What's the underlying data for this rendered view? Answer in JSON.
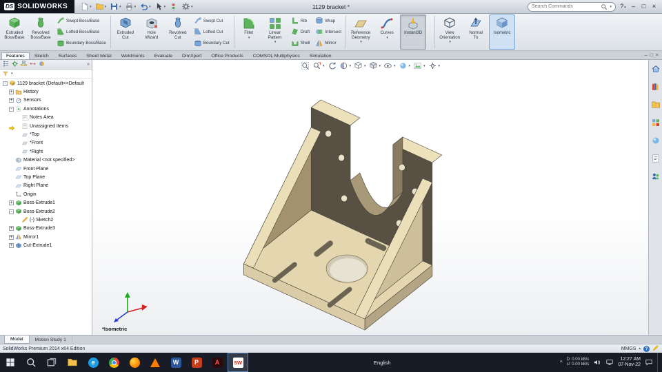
{
  "colors": {
    "accent_blue": "#2f6fc1",
    "model_tan": "#e4d7af",
    "model_dark": "#575043",
    "taskbar_bg": "#171c26"
  },
  "title_bar": {
    "brand_mark": "DS",
    "brand": "SOLIDWORKS",
    "document_title": "1129 bracket *",
    "search": {
      "placeholder": "Search Commands"
    },
    "qat": [
      {
        "name": "new-document",
        "caret": true
      },
      {
        "name": "open-folder",
        "caret": true
      },
      {
        "name": "save",
        "caret": true
      },
      {
        "name": "print",
        "caret": true
      },
      {
        "name": "undo",
        "caret": true
      },
      {
        "name": "select-arrow",
        "caret": true
      },
      {
        "name": "rebuild",
        "caret": false
      },
      {
        "name": "options-gear",
        "caret": true
      }
    ],
    "window_buttons": [
      "help",
      "minimize",
      "restore",
      "close"
    ]
  },
  "ribbon": {
    "groups": [
      {
        "buttons": [
          {
            "label": "Extruded\nBoss/Base",
            "icon": "extruded-boss",
            "size": "large"
          },
          {
            "label": "Revolved\nBoss/Base",
            "icon": "revolved-boss",
            "size": "large"
          },
          {
            "stack": [
              {
                "label": "Swept Boss/Base",
                "icon": "swept-boss"
              },
              {
                "label": "Lofted Boss/Base",
                "icon": "lofted-boss"
              },
              {
                "label": "Boundary Boss/Base",
                "icon": "boundary-boss"
              }
            ]
          }
        ]
      },
      {
        "buttons": [
          {
            "label": "Extruded\nCut",
            "icon": "extruded-cut",
            "size": "large"
          },
          {
            "label": "Hole\nWizard",
            "icon": "hole-wizard",
            "size": "large"
          },
          {
            "label": "Revolved\nCut",
            "icon": "revolved-cut",
            "size": "large"
          },
          {
            "stack": [
              {
                "label": "Swept Cut",
                "icon": "swept-cut"
              },
              {
                "label": "Lofted Cut",
                "icon": "lofted-cut"
              },
              {
                "label": "Boundary Cut",
                "icon": "boundary-cut"
              }
            ]
          }
        ]
      },
      {
        "buttons": [
          {
            "label": "Fillet",
            "icon": "fillet",
            "size": "large",
            "caret": true
          },
          {
            "label": "Linear\nPattern",
            "icon": "linear-pattern",
            "size": "large",
            "caret": true
          },
          {
            "stack": [
              {
                "label": "Rib",
                "icon": "rib"
              },
              {
                "label": "Draft",
                "icon": "draft"
              },
              {
                "label": "Shell",
                "icon": "shell"
              }
            ]
          },
          {
            "stack": [
              {
                "label": "Wrap",
                "icon": "wrap"
              },
              {
                "label": "Intersect",
                "icon": "intersect"
              },
              {
                "label": "Mirror",
                "icon": "mirror"
              }
            ]
          }
        ]
      },
      {
        "buttons": [
          {
            "label": "Reference\nGeometry",
            "icon": "reference-geometry",
            "size": "large",
            "caret": true
          },
          {
            "label": "Curves",
            "icon": "curves",
            "size": "large",
            "caret": true
          },
          {
            "label": "Instant3D",
            "icon": "instant3d",
            "size": "large",
            "pressed": true
          }
        ]
      },
      {
        "buttons": [
          {
            "label": "View\nOrientation",
            "icon": "view-orientation",
            "size": "large",
            "caret": true
          },
          {
            "label": "Normal\nTo",
            "icon": "normal-to",
            "size": "large"
          },
          {
            "label": "Isometric",
            "icon": "isometric-view",
            "size": "large",
            "selected": true
          }
        ]
      }
    ]
  },
  "command_tabs": {
    "items": [
      "Features",
      "Sketch",
      "Surfaces",
      "Sheet Metal",
      "Weldments",
      "Evaluate",
      "DimXpert",
      "Office Products",
      "COMSOL Multiphysics",
      "Simulation"
    ],
    "active": "Features",
    "window_controls": [
      "minimize",
      "restore",
      "close"
    ]
  },
  "feature_tree": {
    "header_icons": [
      "featuremanager",
      "propertymanager",
      "configurationmanager",
      "dimxpertmanager",
      "displaymanager"
    ],
    "items": [
      {
        "label": "1129 bracket  (Default<<Default",
        "icon": "part",
        "depth": 0,
        "expander": "open"
      },
      {
        "label": "History",
        "icon": "history",
        "depth": 1,
        "expander": "closed"
      },
      {
        "label": "Sensors",
        "icon": "sensors",
        "depth": 1,
        "expander": "closed"
      },
      {
        "label": "Annotations",
        "icon": "annotations",
        "depth": 1,
        "expander": "open"
      },
      {
        "label": "Notes Area",
        "icon": "notes",
        "depth": 2
      },
      {
        "label": "Unassigned Items",
        "icon": "notes",
        "depth": 2,
        "marker": true
      },
      {
        "label": "*Top",
        "icon": "annot-view",
        "depth": 2
      },
      {
        "label": "*Front",
        "icon": "annot-view",
        "depth": 2
      },
      {
        "label": "*Right",
        "icon": "annot-view",
        "depth": 2
      },
      {
        "label": "Material <not specified>",
        "icon": "material",
        "depth": 1
      },
      {
        "label": "Front Plane",
        "icon": "plane",
        "depth": 1
      },
      {
        "label": "Top Plane",
        "icon": "plane",
        "depth": 1
      },
      {
        "label": "Right Plane",
        "icon": "plane",
        "depth": 1
      },
      {
        "label": "Origin",
        "icon": "origin",
        "depth": 1
      },
      {
        "label": "Boss-Extrude1",
        "icon": "boss-extrude",
        "depth": 1,
        "expander": "closed"
      },
      {
        "label": "Boss-Extrude2",
        "icon": "boss-extrude",
        "depth": 1,
        "expander": "open"
      },
      {
        "label": "(-) Sketch2",
        "icon": "sketch",
        "depth": 2
      },
      {
        "label": "Boss-Extrude3",
        "icon": "boss-extrude",
        "depth": 1,
        "expander": "closed"
      },
      {
        "label": "Mirror1",
        "icon": "mirror-feature",
        "depth": 1,
        "expander": "closed"
      },
      {
        "label": "Cut-Extrude1",
        "icon": "cut-extrude",
        "depth": 1,
        "expander": "closed"
      }
    ]
  },
  "hud_toolbar": [
    {
      "name": "zoom-fit"
    },
    {
      "name": "zoom-area",
      "caret": true
    },
    {
      "name": "previous-view"
    },
    {
      "name": "section-view",
      "caret": true
    },
    {
      "name": "view-orientation",
      "caret": true
    },
    {
      "name": "display-style",
      "caret": true
    },
    {
      "name": "hide-show-items",
      "caret": true
    },
    {
      "name": "edit-appearance",
      "caret": true
    },
    {
      "name": "scene",
      "caret": true
    },
    {
      "name": "view-settings",
      "caret": true
    }
  ],
  "viewport": {
    "view_label": "*Isometric"
  },
  "task_pane": [
    "resources",
    "design-library",
    "file-explorer",
    "view-palette",
    "appearances",
    "custom-properties",
    "forum"
  ],
  "document_tabs": [
    {
      "label": "Model",
      "active": true
    },
    {
      "label": "Motion Study 1",
      "active": false
    }
  ],
  "status_bar": {
    "edition": "SolidWorks Premium 2014 x64 Edition",
    "units": "MMGS"
  },
  "taskbar": {
    "apps": [
      {
        "name": "start"
      },
      {
        "name": "search"
      },
      {
        "name": "task-view"
      },
      {
        "name": "file-explorer"
      },
      {
        "name": "edge"
      },
      {
        "name": "chrome"
      },
      {
        "name": "firefox"
      },
      {
        "name": "vlc"
      },
      {
        "name": "word"
      },
      {
        "name": "powerpoint"
      },
      {
        "name": "adobe"
      },
      {
        "name": "solidworks",
        "active": true
      }
    ],
    "language": "English",
    "tray": {
      "net_down": "D: 0.00 kB/s",
      "net_up": "U: 0.00 kB/s",
      "time": "12:27 AM",
      "date": "07-Nov-22"
    }
  }
}
